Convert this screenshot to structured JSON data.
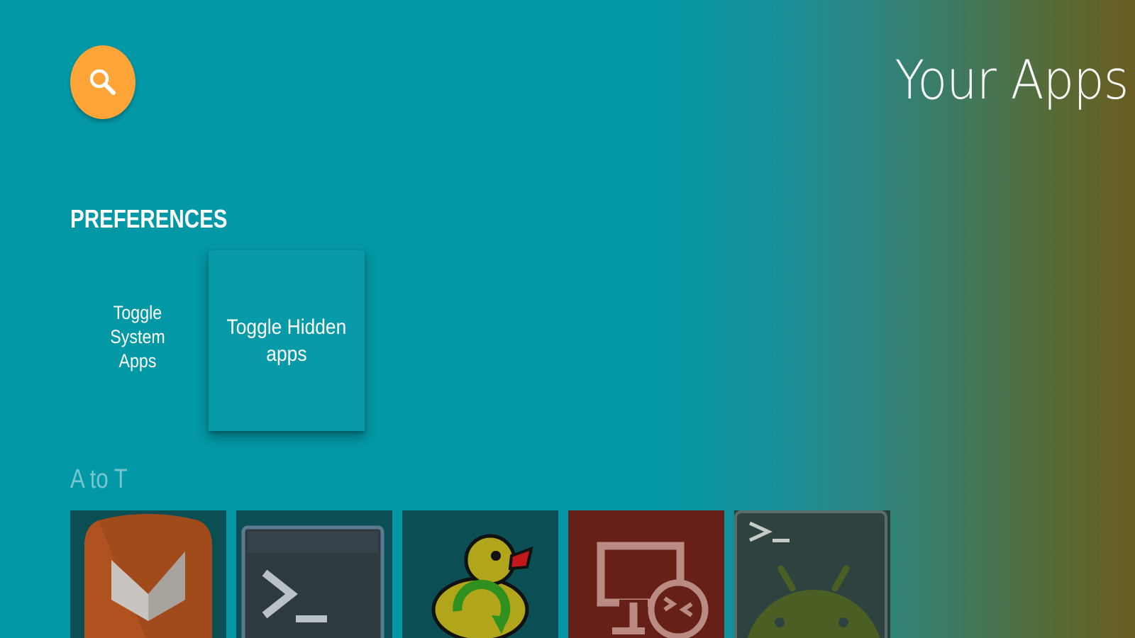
{
  "header": {
    "title": "Your Apps",
    "search_icon": "search-icon"
  },
  "sections": {
    "preferences": {
      "title": "PREFERENCES",
      "items": [
        {
          "line1": "Toggle System",
          "line2": "Apps"
        },
        {
          "line1": "Toggle Hidden",
          "line2": "apps"
        }
      ]
    },
    "apps": {
      "title": "A to T",
      "items": [
        {
          "icon": "aptoide-icon"
        },
        {
          "icon": "terminal-icon"
        },
        {
          "icon": "duck-sync-icon"
        },
        {
          "icon": "remote-desktop-icon"
        },
        {
          "icon": "android-terminal-icon"
        }
      ]
    }
  },
  "colors": {
    "accent": "#ffa436",
    "background": "#0398a6",
    "card": "#089aa8"
  }
}
